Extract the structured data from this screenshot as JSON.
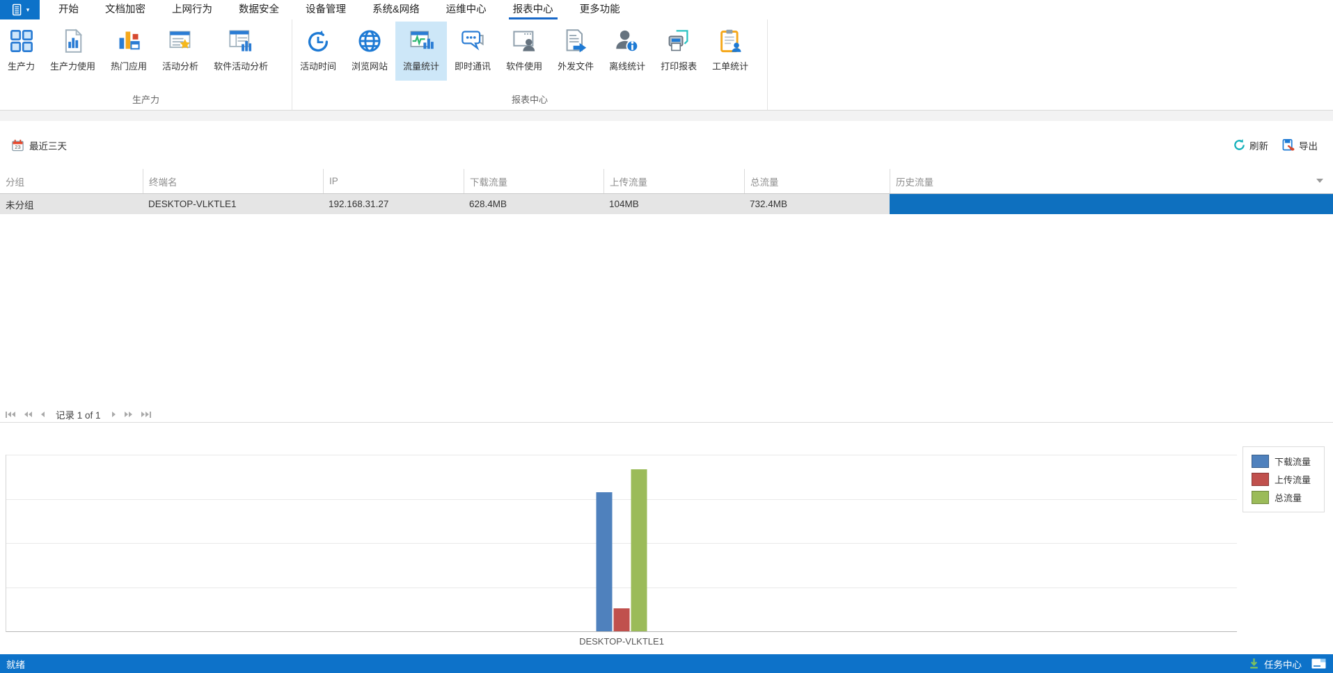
{
  "app": {
    "tabs": [
      {
        "label": "开始"
      },
      {
        "label": "文档加密"
      },
      {
        "label": "上网行为"
      },
      {
        "label": "数据安全"
      },
      {
        "label": "设备管理"
      },
      {
        "label": "系统&网络"
      },
      {
        "label": "运维中心"
      },
      {
        "label": "报表中心",
        "selected": true
      },
      {
        "label": "更多功能"
      }
    ]
  },
  "ribbon": {
    "groups": [
      {
        "label": "生产力",
        "items": [
          {
            "label": "生产力"
          },
          {
            "label": "生产力使用"
          },
          {
            "label": "热门应用"
          },
          {
            "label": "活动分析"
          },
          {
            "label": "软件活动分析"
          }
        ]
      },
      {
        "label": "报表中心",
        "items": [
          {
            "label": "活动时间"
          },
          {
            "label": "浏览网站"
          },
          {
            "label": "流量统计",
            "selected": true
          },
          {
            "label": "即时通讯"
          },
          {
            "label": "软件使用"
          },
          {
            "label": "外发文件"
          },
          {
            "label": "离线统计"
          },
          {
            "label": "打印报表"
          },
          {
            "label": "工单统计"
          }
        ]
      }
    ]
  },
  "toolbar": {
    "date_range": "最近三天",
    "refresh_label": "刷新",
    "export_label": "导出"
  },
  "table": {
    "columns": [
      "分组",
      "终端名",
      "IP",
      "下载流量",
      "上传流量",
      "总流量",
      "历史流量"
    ],
    "rows": [
      {
        "cells": [
          "未分组",
          "DESKTOP-VLKTLE1",
          "192.168.31.27",
          "628.4MB",
          "104MB",
          "732.4MB"
        ],
        "history_bar_percent": 100
      }
    ]
  },
  "pagination": {
    "record_label": "记录 1 of 1"
  },
  "chart_data": {
    "type": "bar",
    "categories": [
      "DESKTOP-VLKTLE1"
    ],
    "series": [
      {
        "name": "下载流量",
        "color": "#4f81bd",
        "values": [
          628.4
        ]
      },
      {
        "name": "上传流量",
        "color": "#c0504d",
        "values": [
          104
        ]
      },
      {
        "name": "总流量",
        "color": "#9bbb59",
        "values": [
          732.4
        ]
      }
    ],
    "unit": "MB",
    "ylim": [
      0,
      800
    ],
    "gridline_step": 200,
    "y_axis_labels_visible": false,
    "legend_position": "top-right"
  },
  "status_bar": {
    "ready": "就绪",
    "task_center": "任务中心"
  },
  "colors": {
    "accent_blue": "#0d72c9",
    "tab_underline": "#1868c8",
    "ribbon_selected_bg": "#cde7f8",
    "history_bar": "#0e70bf",
    "row_bg": "#e5e5e5"
  }
}
